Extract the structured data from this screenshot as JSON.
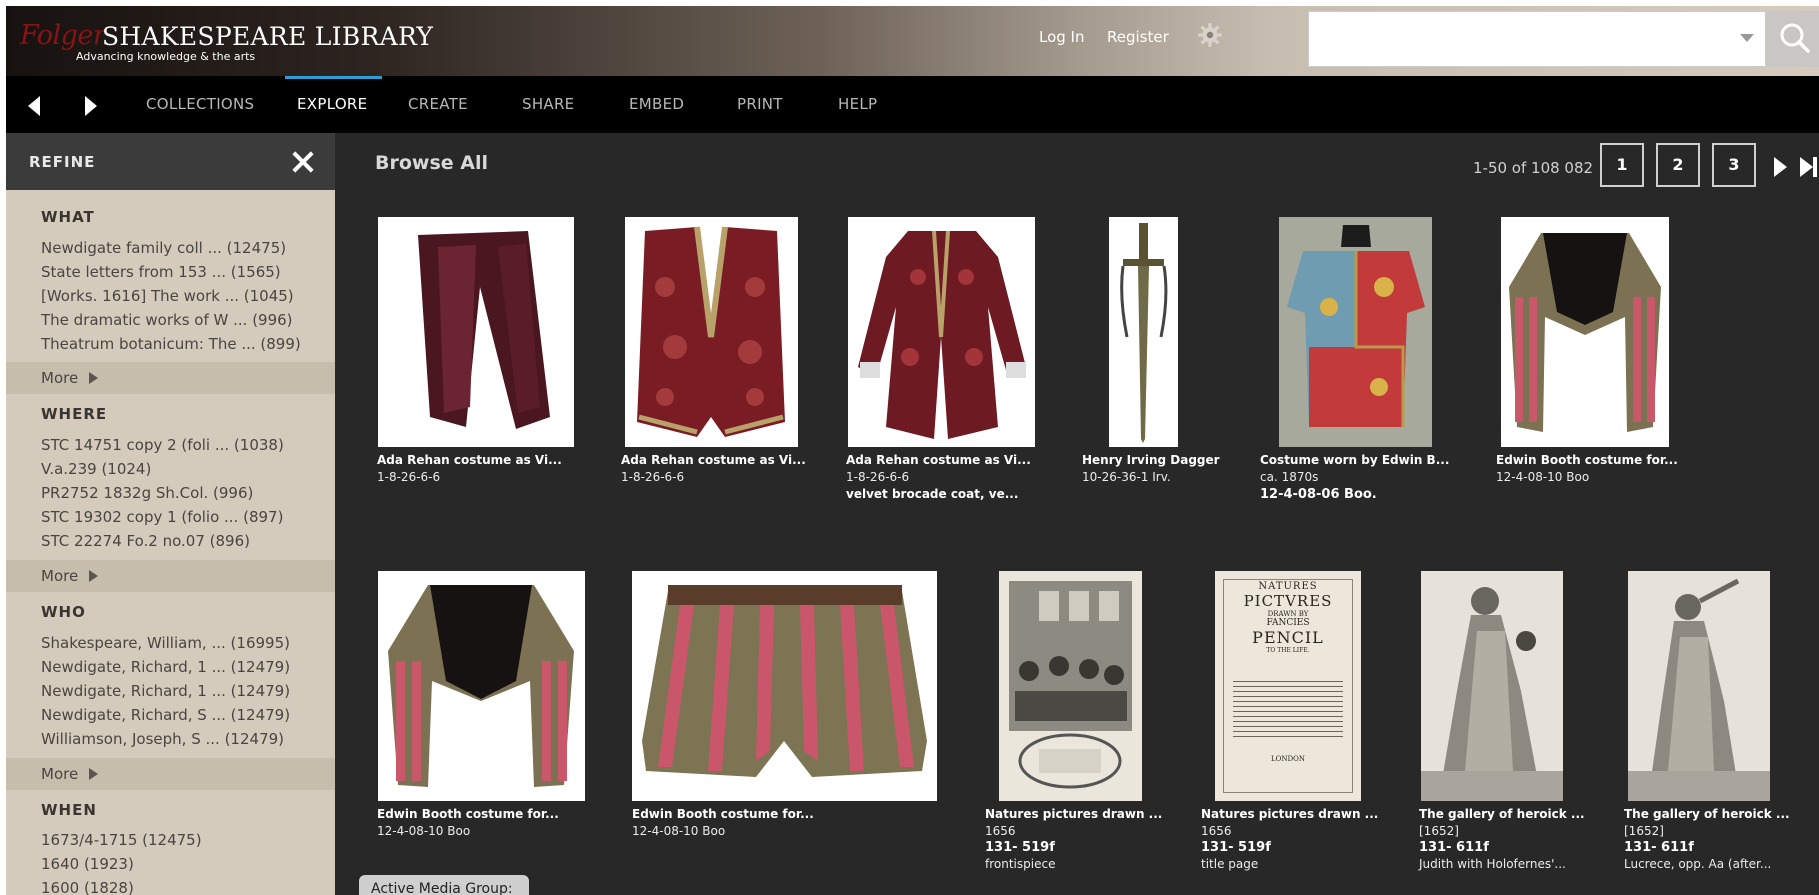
{
  "header": {
    "logo_folger": "Folger",
    "logo_main": "SHAKESPEARE LIBRARY",
    "logo_tagline": "Advancing knowledge & the arts",
    "login": "Log In",
    "register": "Register",
    "search_placeholder": ""
  },
  "nav": {
    "items": [
      "COLLECTIONS",
      "EXPLORE",
      "CREATE",
      "SHARE",
      "EMBED",
      "PRINT",
      "HELP"
    ],
    "active": "EXPLORE"
  },
  "sidebar": {
    "title": "REFINE",
    "more_label": "More",
    "facets": [
      {
        "head": "WHAT",
        "items": [
          "Newdigate family coll ... (12475)",
          "State letters from 153 ... (1565)",
          "[Works. 1616] The work ... (1045)",
          "The dramatic works of W ... (996)",
          "Theatrum botanicum: The ... (899)"
        ]
      },
      {
        "head": "WHERE",
        "items": [
          "STC 14751 copy 2 (foli ... (1038)",
          "V.a.239 (1024)",
          "PR2752 1832g Sh.Col. (996)",
          "STC 19302 copy 1 (folio ... (897)",
          "STC 22274 Fo.2 no.07 (896)"
        ]
      },
      {
        "head": "WHO",
        "items": [
          "Shakespeare, William, ... (16995)",
          "Newdigate, Richard, 1 ... (12479)",
          "Newdigate, Richard, 1 ... (12479)",
          "Newdigate, Richard, S ... (12479)",
          "Williamson, Joseph, S ... (12479)"
        ]
      },
      {
        "head": "WHEN",
        "items": [
          "1673/4-1715 (12475)",
          "1640 (1923)",
          "1600 (1828)"
        ]
      }
    ]
  },
  "main": {
    "title": "Browse All",
    "range": "1-50 of 108 082",
    "pages": [
      "1",
      "2",
      "3"
    ],
    "active_media": "Active Media Group:"
  },
  "cards": [
    {
      "title": "Ada Rehan costume as Vi...",
      "l1": "1-8-26-6-6",
      "l2": "",
      "l3": ""
    },
    {
      "title": "Ada Rehan costume as Vi...",
      "l1": "1-8-26-6-6",
      "l2": "",
      "l3": ""
    },
    {
      "title": "Ada Rehan costume as Vi...",
      "l1": "1-8-26-6-6",
      "l2": "velvet brocade coat, ve...",
      "l3": ""
    },
    {
      "title": "Henry Irving Dagger",
      "l1": "10-26-36-1 Irv.",
      "l2": "",
      "l3": ""
    },
    {
      "title": "Costume worn by Edwin B...",
      "l1": "ca. 1870s",
      "l2": "12-4-08-06 Boo.",
      "l3": ""
    },
    {
      "title": "Edwin Booth costume for...",
      "l1": "12-4-08-10 Boo",
      "l2": "",
      "l3": ""
    },
    {
      "title": "Edwin Booth costume for...",
      "l1": "12-4-08-10 Boo",
      "l2": "",
      "l3": ""
    },
    {
      "title": "Edwin Booth costume for...",
      "l1": "12-4-08-10 Boo",
      "l2": "",
      "l3": ""
    },
    {
      "title": "Natures pictures drawn ...",
      "l1": "1656",
      "l2": "131- 519f",
      "l3": "frontispiece"
    },
    {
      "title": "Natures pictures drawn ...",
      "l1": "1656",
      "l2": "131- 519f",
      "l3": "title page"
    },
    {
      "title": "The gallery of heroick ...",
      "l1": "[1652]",
      "l2": "131- 611f",
      "l3": "Judith with Holofernes'..."
    },
    {
      "title": "The gallery of heroick ...",
      "l1": "[1652]",
      "l2": "131- 611f",
      "l3": "Lucrece, opp. Aa (after..."
    }
  ],
  "book_page": {
    "l1": "NATURES",
    "l2": "PICTVRES",
    "l3": "DRAWN BY",
    "l4": "FANCIES",
    "l5": "PENCIL",
    "l6": "TO THE LIFE.",
    "l7": "LONDON"
  },
  "colors": {
    "accent": "#2b9fd8",
    "sidebar": "#d4cbbd",
    "main_bg": "#282828"
  }
}
